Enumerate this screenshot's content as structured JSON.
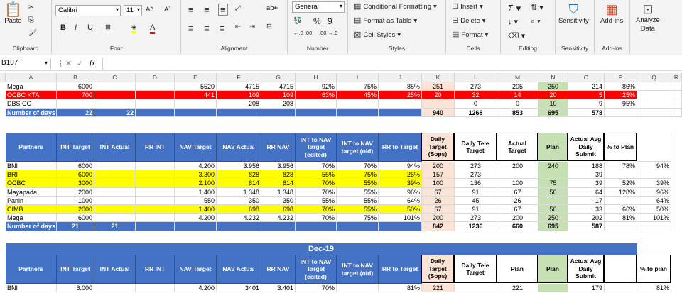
{
  "ribbon": {
    "clipboard": {
      "paste": "Paste",
      "label": "Clipboard"
    },
    "font": {
      "name": "Calibri",
      "size": "11",
      "grow": "A^",
      "shrink": "Aˇ",
      "bold": "B",
      "italic": "I",
      "underline": "U",
      "label": "Font"
    },
    "alignment": {
      "label": "Alignment"
    },
    "number": {
      "format": "General",
      "percent": "%",
      "comma": "9",
      "inc": "←.0 .00",
      "dec": ".00 →.0",
      "label": "Number"
    },
    "styles": {
      "cond": "Conditional Formatting",
      "table": "Format as Table",
      "cell": "Cell Styles",
      "label": "Styles"
    },
    "cells": {
      "insert": "Insert",
      "delete": "Delete",
      "format": "Format",
      "label": "Cells"
    },
    "editing": {
      "label": "Editing"
    },
    "sensitivity": {
      "btn": "Sensitivity",
      "label": "Sensitivity"
    },
    "addins": {
      "btn": "Add-ins",
      "label": "Add-ins"
    },
    "analyze": {
      "btn1": "Analyze",
      "btn2": "Data"
    }
  },
  "formula_bar": {
    "name_box": "B107",
    "fx": "fx",
    "formula": ""
  },
  "columns": [
    "A",
    "B",
    "C",
    "D",
    "E",
    "F",
    "G",
    "H",
    "I",
    "J",
    "K",
    "L",
    "M",
    "N",
    "O",
    "P",
    "Q",
    "R"
  ],
  "colors": {
    "header_blue": "#4472c4",
    "red": "#ff0000",
    "yellow": "#ffff00",
    "peach": "#fbe4d6",
    "green": "#c6e0b4"
  },
  "top_rows": [
    [
      "Mega",
      "6000",
      "",
      "",
      "5520",
      "4715",
      "4715",
      "92%",
      "75%",
      "85%",
      "251",
      "273",
      "205",
      "250",
      "214",
      "86%",
      "",
      ""
    ],
    [
      "OCBC KTA",
      "700",
      "",
      "",
      "441",
      "109",
      "109",
      "63%",
      "45%",
      "25%",
      "20",
      "32",
      "14",
      "20",
      "5",
      "25%",
      "",
      ""
    ],
    [
      "DBS CC",
      "",
      "",
      "",
      "",
      "208",
      "208",
      "",
      "",
      "",
      "",
      "0",
      "0",
      "10",
      "9",
      "95%",
      "",
      ""
    ],
    [
      "Number of days",
      "22",
      "22",
      "",
      "",
      "",
      "",
      "",
      "",
      "",
      "940",
      "1268",
      "853",
      "695",
      "578",
      "",
      "",
      ""
    ]
  ],
  "table1": {
    "headers": [
      "Partners",
      "INT Target",
      "INT Actual",
      "RR INT",
      "NAV Target",
      "NAV Actual",
      "RR NAV",
      "INT to NAV Target (edited)",
      "INT to NAV target (old)",
      "RR to Target",
      "Daily Target (Sops)",
      "Daily Tele Target",
      "Actual Target",
      "Plan",
      "Actual Avg Daily Submit",
      "% to Plan",
      ""
    ],
    "rows": [
      [
        "BNI",
        "6000",
        "",
        "",
        "4.200",
        "3.956",
        "3.956",
        "70%",
        "70%",
        "94%",
        "200",
        "273",
        "200",
        "240",
        "188",
        "78%",
        "94%"
      ],
      [
        "BRI",
        "6000",
        "",
        "",
        "3.300",
        "828",
        "828",
        "55%",
        "75%",
        "25%",
        "157",
        "273",
        "",
        "",
        "39",
        "",
        ""
      ],
      [
        "OCBC",
        "3000",
        "",
        "",
        "2.100",
        "814",
        "814",
        "70%",
        "55%",
        "39%",
        "100",
        "136",
        "100",
        "75",
        "39",
        "52%",
        "39%"
      ],
      [
        "Mayapada",
        "2000",
        "",
        "",
        "1.400",
        "1.348",
        "1.348",
        "70%",
        "55%",
        "96%",
        "67",
        "91",
        "67",
        "50",
        "64",
        "128%",
        "96%"
      ],
      [
        "Panin",
        "1000",
        "",
        "",
        "550",
        "350",
        "350",
        "55%",
        "55%",
        "64%",
        "26",
        "45",
        "26",
        "",
        "17",
        "",
        "64%"
      ],
      [
        "CIMB",
        "2000",
        "",
        "",
        "1.400",
        "698",
        "698",
        "70%",
        "55%",
        "50%",
        "67",
        "91",
        "67",
        "50",
        "33",
        "66%",
        "50%"
      ],
      [
        "Mega",
        "6000",
        "",
        "",
        "4.200",
        "4.232",
        "4.232",
        "70%",
        "75%",
        "101%",
        "200",
        "273",
        "200",
        "250",
        "202",
        "81%",
        "101%"
      ],
      [
        "Number of days",
        "21",
        "21",
        "",
        "",
        "",
        "",
        "",
        "",
        "",
        "842",
        "1236",
        "660",
        "695",
        "587",
        "",
        ""
      ]
    ]
  },
  "table2": {
    "title": "Dec-19",
    "headers": [
      "Partners",
      "INT Target",
      "INT Actual",
      "RR INT",
      "NAV Target",
      "NAV Actual",
      "RR NAV",
      "INT to NAV Target (edited)",
      "INT to NAV target (old)",
      "RR to Target",
      "Daily Target (Sops)",
      "Daily Tele Target",
      "Plan",
      "Plan",
      "Actual Avg Daily Submit",
      "",
      "% to plan"
    ],
    "rows": [
      [
        "BNI",
        "6.000",
        "",
        "",
        "4.200",
        "3401",
        "3.401",
        "70%",
        "",
        "81%",
        "221",
        "",
        "221",
        "",
        "179",
        "",
        "81%"
      ]
    ]
  }
}
